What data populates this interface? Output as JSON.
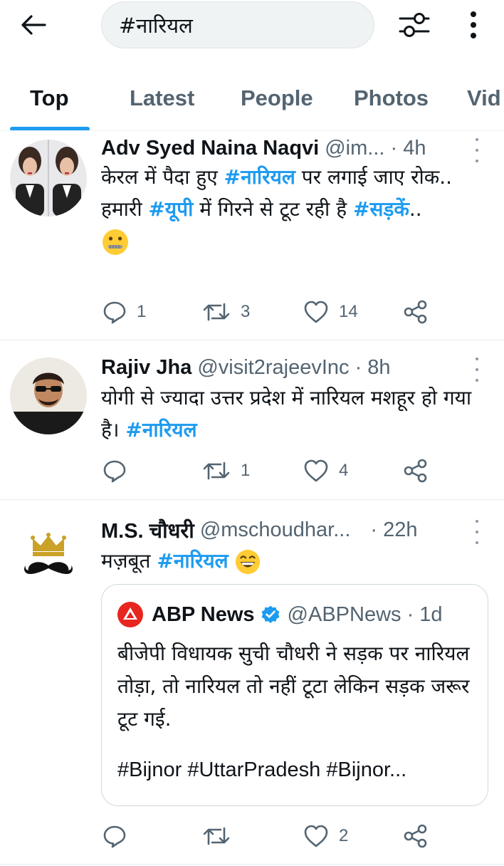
{
  "search": {
    "query": "#नारियल"
  },
  "tabs": [
    {
      "label": "Top"
    },
    {
      "label": "Latest"
    },
    {
      "label": "People"
    },
    {
      "label": "Photos"
    },
    {
      "label": "Vid"
    }
  ],
  "tweets": [
    {
      "name": "Adv Syed Naina Naqvi",
      "handle": "@im... · 4h",
      "line1_a": "केरल में पैदा हुए ",
      "line1_tag": "#नारियल",
      "line1_b": " पर लगाई जाए रोक..",
      "line2_a": "हमारी ",
      "line2_tag1": "#यूपी",
      "line2_b": " में गिरने से टूट रही है ",
      "line2_tag2": "#सड़कें",
      "line2_c": "..",
      "emoji": "zipper-mouth-face-emoji",
      "replies": "1",
      "retweets": "3",
      "likes": "14"
    },
    {
      "name": "Rajiv Jha",
      "handle": "@visit2rajeevInc · 8h",
      "text_a": "योगी से ज्यादा उत्तर प्रदेश में नारियल मशहूर हो गया है। ",
      "text_tag": "#नारियल",
      "replies": "",
      "retweets": "1",
      "likes": "4"
    },
    {
      "name": "M.S. चौधरी",
      "handle": "@mschoudhar...",
      "time": "· 22h",
      "text_a": "मज़बूत ",
      "text_tag": "#नारियल",
      "emoji": "grinning-face-emoji",
      "quote": {
        "name": "ABP News",
        "handle": "@ABPNews · 1d",
        "text": "बीजेपी विधायक सुची चौधरी ने सड़क पर नारियल तोड़ा, तो नारियल तो नहीं टूटा लेकिन सड़क जरूर टूट गई.",
        "tags": "#Bijnor #UttarPradesh #Bijnor..."
      },
      "replies": "",
      "retweets": "",
      "likes": "2"
    }
  ],
  "colors": {
    "accent": "#1d9bf0",
    "secondary_text": "#536471",
    "abp_red": "#e8251f"
  }
}
